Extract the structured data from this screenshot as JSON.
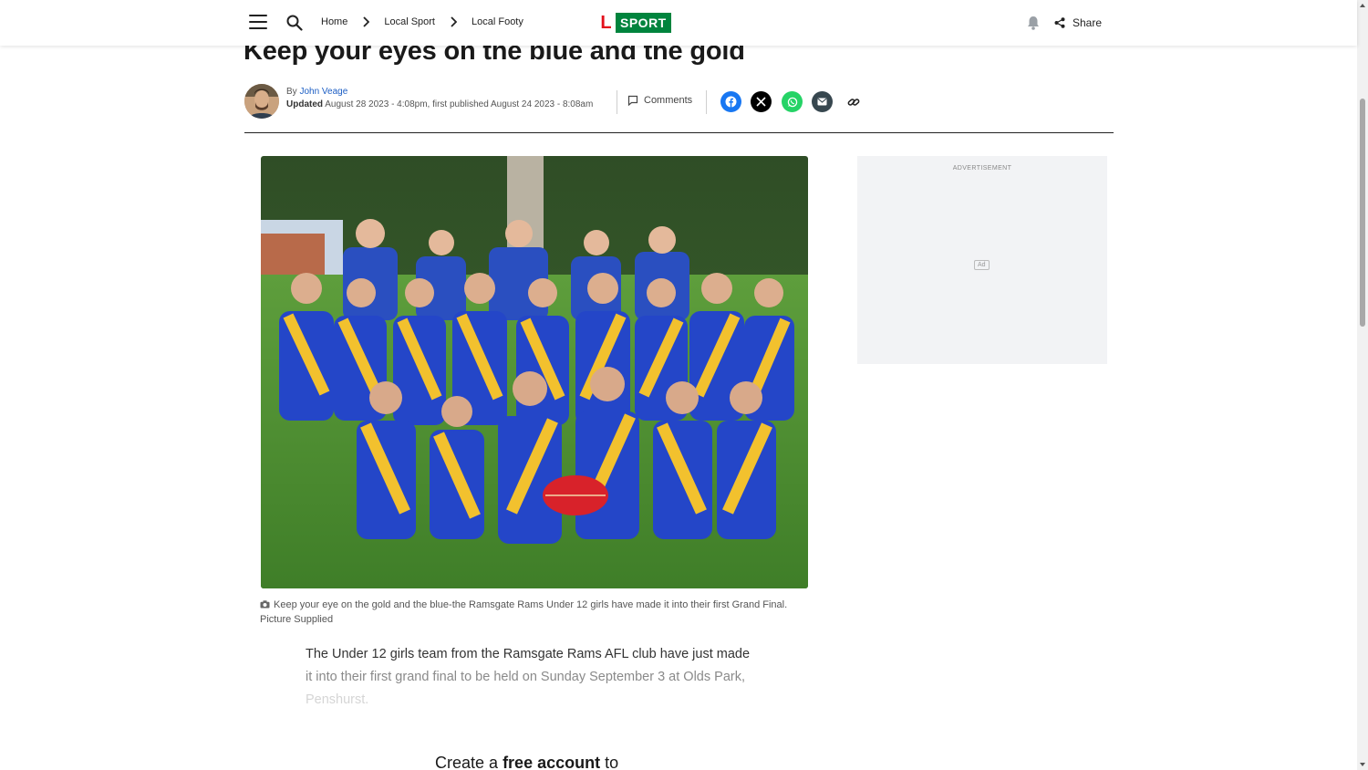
{
  "nav": {
    "breadcrumbs": [
      "Home",
      "Local Sport",
      "Local Footy"
    ],
    "logo_letter": "L",
    "logo_text": "SPORT",
    "share_label": "Share"
  },
  "article": {
    "headline": "Keep your eyes on the blue and the gold",
    "by_prefix": "By",
    "author": "John Veage",
    "updated_label": "Updated",
    "dates": "August 28 2023 - 4:08pm, first published August 24 2023 - 8:08am",
    "comments_label": "Comments",
    "caption": "Keep your eye on the gold and the blue-the Ramsgate Rams Under 12 girls have made it into their first Grand Final. Picture Supplied",
    "lead_line1": "The Under 12 girls team from the Ramsgate Rams AFL club have just made",
    "lead_line2": "it into their first grand final to be held on Sunday September 3 at Olds Park,",
    "lead_line3": "Penshurst.",
    "cta_prefix": "Create a",
    "cta_bold": "free account",
    "cta_suffix": "to"
  },
  "ad": {
    "label": "ADVERTISEMENT",
    "badge": "Ad"
  },
  "colors": {
    "logo_red": "#e3101b",
    "logo_green": "#00843d",
    "link_blue": "#1c5ec4",
    "facebook": "#1877f2",
    "x": "#000000",
    "whatsapp": "#25d366",
    "email": "#37474f"
  },
  "icons": [
    "menu-icon",
    "search-icon",
    "chevron-right-icon",
    "bell-icon",
    "share-icon",
    "comment-icon",
    "facebook-icon",
    "x-icon",
    "whatsapp-icon",
    "email-icon",
    "link-icon",
    "camera-icon"
  ]
}
